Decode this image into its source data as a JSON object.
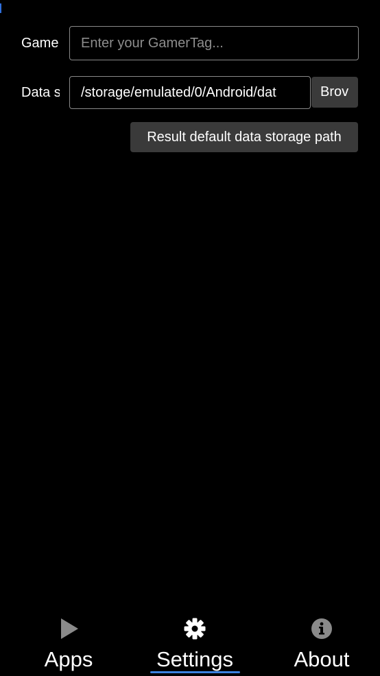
{
  "settings": {
    "gamertag": {
      "label": "Game",
      "value": "",
      "placeholder": "Enter your GamerTag..."
    },
    "data_storage": {
      "label": "Data s",
      "value": "/storage/emulated/0/Android/dat",
      "browse_label": "Brov",
      "reset_label": "Result default data storage path"
    }
  },
  "nav": {
    "active": "settings",
    "accent_color": "#3b82e0",
    "items": [
      {
        "id": "apps",
        "label": "Apps",
        "icon": "play-icon"
      },
      {
        "id": "settings",
        "label": "Settings",
        "icon": "gear-icon"
      },
      {
        "id": "about",
        "label": "About",
        "icon": "info-icon"
      }
    ]
  }
}
